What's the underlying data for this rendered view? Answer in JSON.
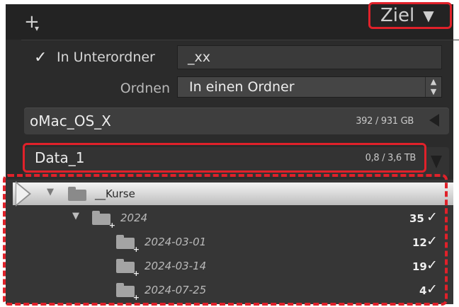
{
  "header": {
    "add_icon": "plus-icon",
    "target_label": "Ziel",
    "target_icon": "triangle-down-icon"
  },
  "options": {
    "subfolder_label": "In Unterordner",
    "subfolder_checked": true,
    "subfolder_value": "_xx",
    "sort_label": "Ordnen",
    "sort_value": "In einen Ordner"
  },
  "volumes": [
    {
      "name": "oMac_OS_X",
      "size": "392 / 931 GB"
    },
    {
      "name": "Data_1",
      "size": "0,8 / 3,6 TB"
    }
  ],
  "folders": [
    {
      "name": "__Kurse",
      "count": "",
      "checked": false
    },
    {
      "name": "2024",
      "count": "35",
      "checked": true
    },
    {
      "name": "2024-03-01",
      "count": "12",
      "checked": true
    },
    {
      "name": "2024-03-14",
      "count": "19",
      "checked": true
    },
    {
      "name": "2024-07-25",
      "count": "4",
      "checked": true
    }
  ],
  "colors": {
    "highlight": "#e0212a",
    "panel": "#2b2b2b"
  }
}
